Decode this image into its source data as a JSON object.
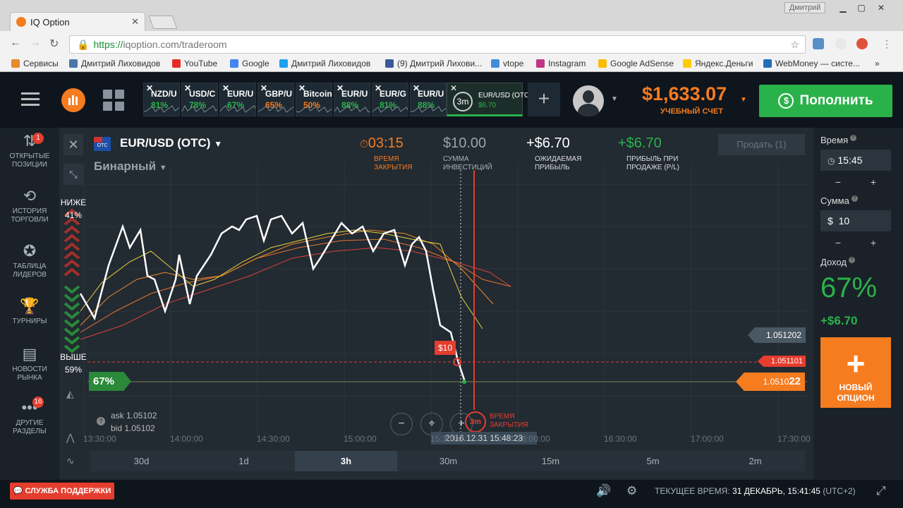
{
  "browser": {
    "tab_title": "IQ Option",
    "user": "Дмитрий",
    "url_https": "https://",
    "url_rest": "iqoption.com/traderoom",
    "bookmarks": [
      "Сервисы",
      "Дмитрий Лиховидов",
      "YouTube",
      "Google",
      "Дмитрий Лиховидов",
      "(9) Дмитрий Лихови...",
      "vtope",
      "Instagram",
      "Google AdSense",
      "Яндекс.Деньги",
      "WebMoney — систе..."
    ],
    "bookmark_colors": [
      "#e98a2c",
      "#4a76a8",
      "#e52d27",
      "#4285f4",
      "#1da1f2",
      "#3b5998",
      "#3f8fd8",
      "#c13584",
      "#fbbc04",
      "#ffcc00",
      "#1d6fb8"
    ]
  },
  "header": {
    "asset_tabs": [
      {
        "name": "NZD/U",
        "pct": "81%",
        "color": "#2ab24a"
      },
      {
        "name": "USD/C",
        "pct": "78%",
        "color": "#2ab24a"
      },
      {
        "name": "EUR/U",
        "pct": "67%",
        "color": "#2ab24a"
      },
      {
        "name": "GBP/U",
        "pct": "65%",
        "color": "#f57c1f"
      },
      {
        "name": "Bitcoin",
        "pct": "50%",
        "color": "#f57c1f"
      },
      {
        "name": "EUR/U",
        "pct": "88%",
        "color": "#2ab24a"
      },
      {
        "name": "EUR/G",
        "pct": "81%",
        "color": "#2ab24a"
      },
      {
        "name": "EUR/U",
        "pct": "88%",
        "color": "#2ab24a"
      }
    ],
    "active_tab": {
      "badge": "3m",
      "name": "EUR/USD (OTC)",
      "profit": "$6.70"
    },
    "balance": "$1,633.07",
    "account": "УЧЕБНЫЙ СЧЕТ",
    "deposit_label": "Пополнить"
  },
  "sidebar": {
    "items": [
      {
        "label1": "ОТКРЫТЫЕ",
        "label2": "ПОЗИЦИИ",
        "icon": "arrows-updown-icon",
        "glyph": "⇅",
        "badge": "1"
      },
      {
        "label1": "ИСТОРИЯ",
        "label2": "ТОРГОВЛИ",
        "icon": "history-icon",
        "glyph": "⟲"
      },
      {
        "label1": "ТАБЛИЦА",
        "label2": "ЛИДЕРОВ",
        "icon": "medal-icon",
        "glyph": "✪"
      },
      {
        "label1": "ТУРНИРЫ",
        "label2": "",
        "icon": "trophy-icon",
        "glyph": "🏆"
      },
      {
        "label1": "НОВОСТИ",
        "label2": "РЫНКА",
        "icon": "news-icon",
        "glyph": "▤"
      },
      {
        "label1": "ДРУГИЕ",
        "label2": "РАЗДЕЛЫ",
        "icon": "more-icon",
        "glyph": "•••",
        "badge": "16"
      }
    ]
  },
  "trade": {
    "pair": "EUR/USD (OTC)",
    "flag_text": "OTC",
    "type": "Бинарный",
    "close_time": "03:15",
    "close_label1": "ВРЕМЯ",
    "close_label2": "ЗАКРЫТИЯ",
    "investment": "$10.00",
    "investment_label1": "СУММА",
    "investment_label2": "ИНВЕСТИЦИЙ",
    "expected": "+$6.70",
    "expected_label1": "ОЖИДАЕМАЯ",
    "expected_label2": "ПРИБЫЛЬ",
    "sell_profit": "+$6.70",
    "sell_profit_label1": "ПРИБЫЛЬ ПРИ",
    "sell_profit_label2": "ПРОДАЖЕ (P/L)",
    "sell_button": "Продать (1)"
  },
  "chart": {
    "low_label": "НИЖЕ",
    "low_pct": "41%",
    "high_label": "ВЫШЕ",
    "high_pct": "59%",
    "payout_marker": "67%",
    "price_tag_1": "1.051202",
    "price_tag_2": "1.051101",
    "price_tag_3_main": "1.0510",
    "price_tag_3_last": "22",
    "investment_marker": "$10",
    "ask": "ask 1.05102",
    "bid": "bid 1.05102",
    "expiry_badge": "3m",
    "expiry_label1": "ВРЕМЯ",
    "expiry_label2": "ЗАКРЫТИЯ",
    "current_time": "2016.12.31 15:48:23",
    "time_labels": [
      "13:30:00",
      "14:00:00",
      "14:30:00",
      "15:00:00",
      "15:30:00",
      "16:00:00",
      "16:30:00",
      "17:00:00",
      "17:30:00"
    ],
    "periods": [
      "30d",
      "1d",
      "3h",
      "30m",
      "15m",
      "5m",
      "2m"
    ],
    "active_period": "3h"
  },
  "right": {
    "time_label": "Время",
    "time_value": "15:45",
    "amount_label": "Сумма",
    "amount_currency": "$",
    "amount_value": "10",
    "income_label": "Доход",
    "income_pct": "67%",
    "income_profit": "+$6.70",
    "new_option1": "НОВЫЙ",
    "new_option2": "ОПЦИОН"
  },
  "footer": {
    "support": "СЛУЖБА ПОДДЕРЖКИ",
    "time_prefix": "ТЕКУЩЕЕ ВРЕМЯ:",
    "time_value": "31 ДЕКАБРЬ, 15:41:45",
    "time_zone": "(UTC+2)"
  }
}
